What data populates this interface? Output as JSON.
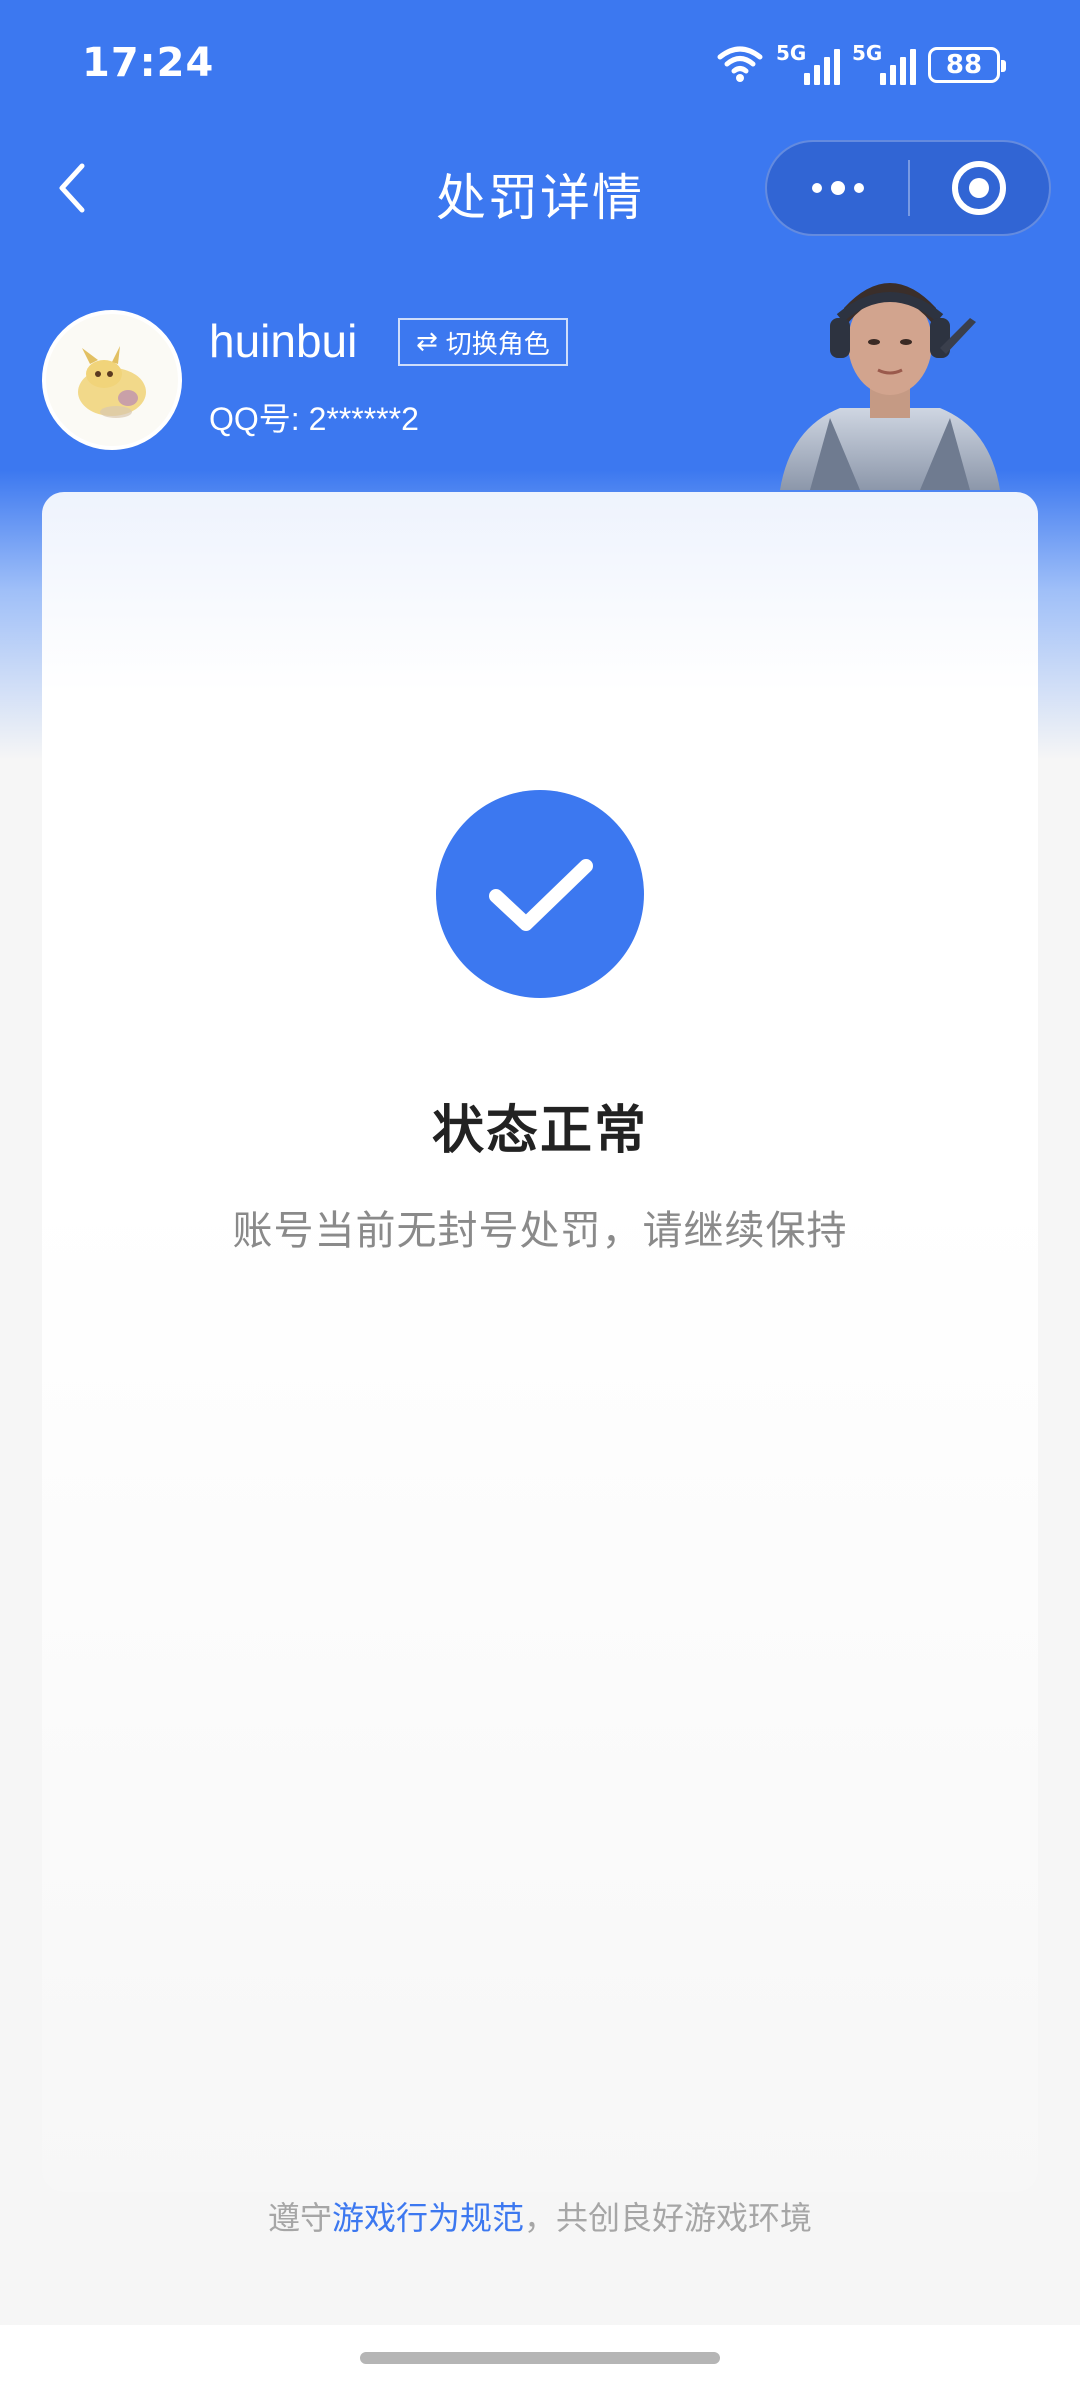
{
  "status_bar": {
    "time": "17:24",
    "network_1": "5G",
    "network_2": "5G",
    "battery": "88"
  },
  "nav": {
    "title": "处罚详情"
  },
  "profile": {
    "username": "huinbui",
    "switch_icon": "⇄",
    "switch_label": "切换角色",
    "qq_label": "QQ号: 2******2"
  },
  "status_card": {
    "title": "状态正常",
    "description": "账号当前无封号处罚，请继续保持"
  },
  "footer": {
    "prefix": "遵守",
    "link": "游戏行为规范",
    "suffix": "，共创良好游戏环境"
  },
  "colors": {
    "brand_blue": "#3c78f0",
    "text_dark": "#222222",
    "text_gray": "#8a8a8a"
  }
}
